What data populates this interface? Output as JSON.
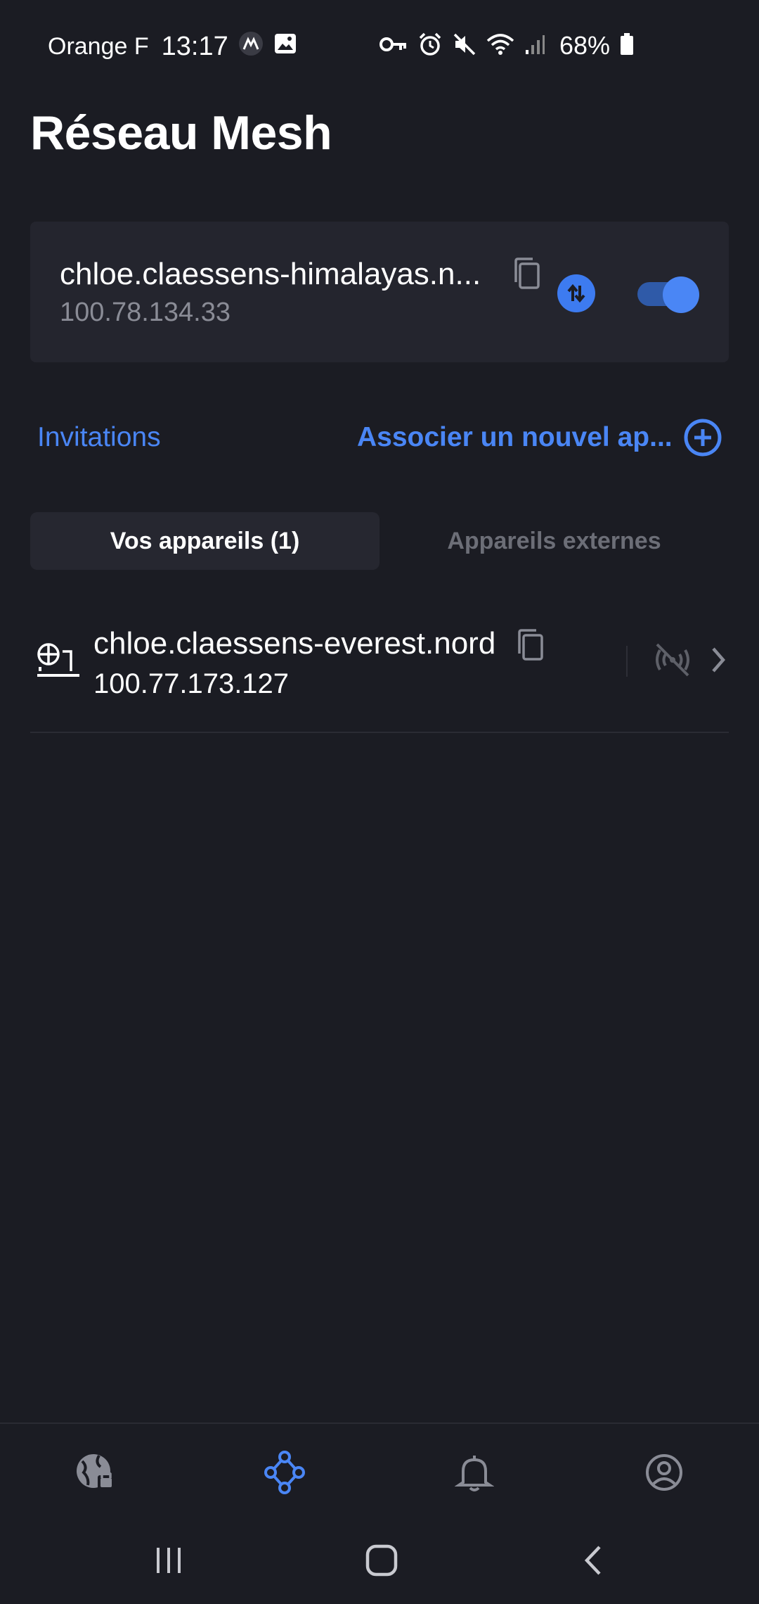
{
  "status_bar": {
    "carrier": "Orange F",
    "time": "13:17",
    "battery": "68%"
  },
  "page": {
    "title": "Réseau Mesh"
  },
  "current_device": {
    "name": "chloe.claessens-himalayas.n...",
    "ip": "100.78.134.33",
    "enabled": true
  },
  "actions": {
    "invitations_label": "Invitations",
    "pair_label": "Associer un nouvel ap..."
  },
  "tabs": [
    {
      "label": "Vos appareils  (1)",
      "active": true
    },
    {
      "label": "Appareils externes",
      "active": false
    }
  ],
  "devices": [
    {
      "name": "chloe.claessens-everest.nord",
      "ip": "100.77.173.127"
    }
  ],
  "bottom_nav": [
    {
      "icon": "globe-lock-icon",
      "active": false
    },
    {
      "icon": "mesh-network-icon",
      "active": true
    },
    {
      "icon": "bell-icon",
      "active": false
    },
    {
      "icon": "account-icon",
      "active": false
    }
  ],
  "colors": {
    "background": "#1b1c23",
    "accent": "#4a86f5",
    "card": "#24252e",
    "muted": "#8a8c96"
  }
}
